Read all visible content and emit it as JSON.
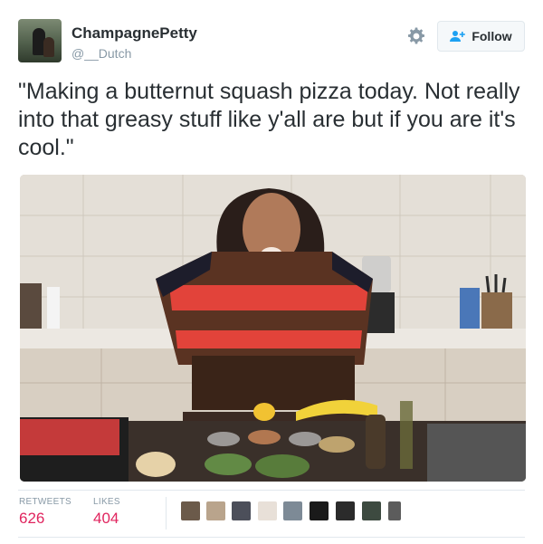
{
  "tweet": {
    "display_name": "ChampagnePetty",
    "handle": "@__Dutch",
    "text": "\"Making a butternut squash pizza today. Not really into that greasy stuff like y'all are but if you are it's cool.\"",
    "follow_label": "Follow"
  },
  "stats": {
    "retweets_label": "RETWEETS",
    "retweets_count": "626",
    "likes_label": "LIKES",
    "likes_count": "404"
  },
  "icons": {
    "settings": "gear-icon",
    "follow": "add-user-icon"
  },
  "colors": {
    "count": "#e0245e",
    "handle": "#8899a6",
    "text": "#292f33"
  },
  "likers": [
    {
      "color": "#6b5a4a"
    },
    {
      "color": "#b9a48c"
    },
    {
      "color": "#4c4f5a"
    },
    {
      "color": "#e8e0d8"
    },
    {
      "color": "#7d8a96"
    },
    {
      "color": "#1a1a1a"
    },
    {
      "color": "#2b2b2b"
    },
    {
      "color": "#3d4a40"
    },
    {
      "color": "#5c5c5c"
    }
  ]
}
